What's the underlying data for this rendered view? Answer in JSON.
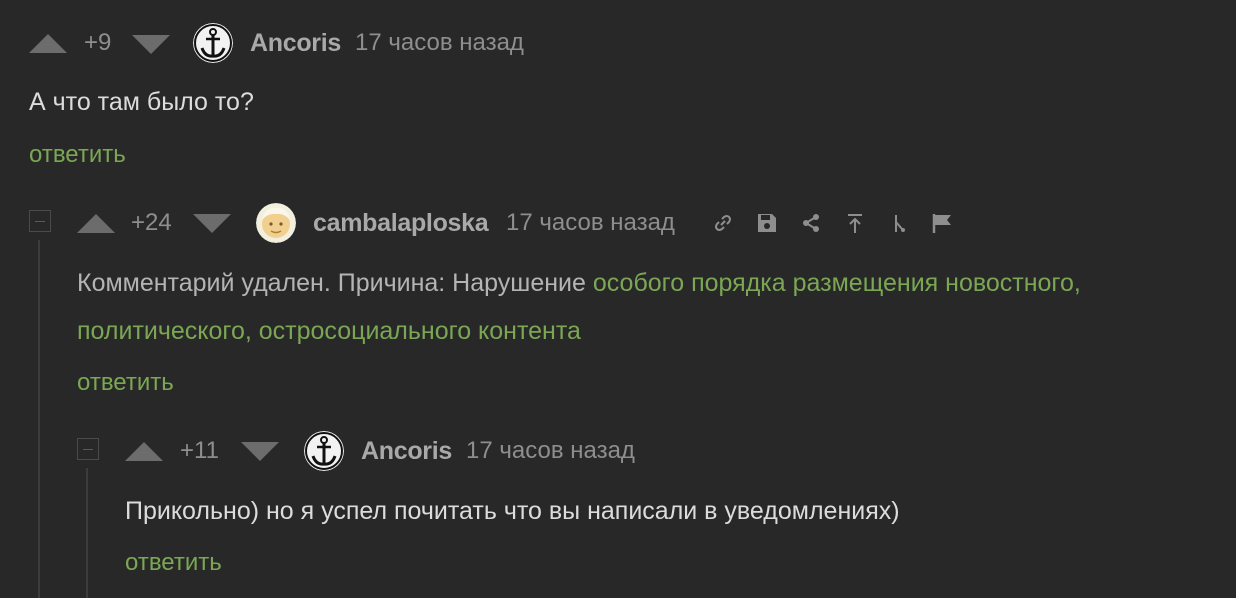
{
  "comments": [
    {
      "score": "+9",
      "username": "Ancoris",
      "time": "17 часов назад",
      "text": "А что там было то?",
      "reply_label": "ответить"
    },
    {
      "score": "+24",
      "username": "cambalaploska",
      "time": "17 часов назад",
      "deleted_prefix": "Комментарий удален. Причина: Нарушение ",
      "deleted_link": "особого порядка размещения новостного, политического, остросоциального контента",
      "reply_label": "ответить",
      "tools": [
        "link-icon",
        "save-icon",
        "share-icon",
        "go-to-parent-icon",
        "branch-icon",
        "report-flag-icon"
      ]
    },
    {
      "score": "+11",
      "username": "Ancoris",
      "time": "17 часов назад",
      "text": "Прикольно) но я успел почитать что вы написали в уведомлениях)",
      "reply_label": "ответить"
    }
  ],
  "colors": {
    "background": "#282828",
    "accent_green": "#7ba755",
    "muted": "#8e8e8e",
    "username": "#a9a9a9"
  }
}
